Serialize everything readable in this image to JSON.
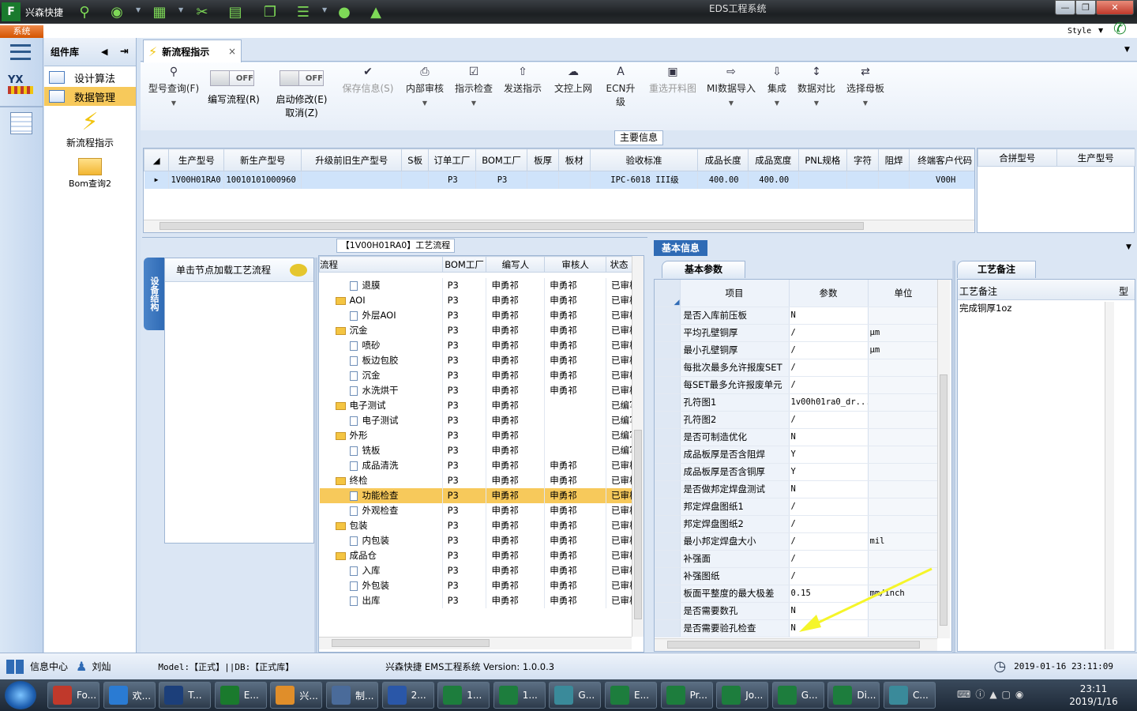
{
  "window": {
    "app_name": "兴森快捷",
    "title": "EDS工程系统",
    "style_label": "Style",
    "system_tab": "系统"
  },
  "sidebar": {
    "header": "组件库",
    "items": [
      {
        "label": "设计算法"
      },
      {
        "label": "数据管理"
      }
    ],
    "actions": [
      {
        "label": "新流程指示"
      },
      {
        "label": "Bom查询2"
      }
    ]
  },
  "tab": {
    "label": "新流程指示"
  },
  "toolbar": {
    "buttons": [
      {
        "label": "型号查询(F)"
      },
      {
        "label": "编写流程(R)",
        "state": "OFF"
      },
      {
        "label": "启动修改(E)",
        "label2": "取消(Z)",
        "state": "OFF"
      },
      {
        "label": "保存信息(S)"
      },
      {
        "label": "内部审核"
      },
      {
        "label": "指示检查"
      },
      {
        "label": "发送指示"
      },
      {
        "label": "文控上网"
      },
      {
        "label": "ECN升级"
      },
      {
        "label": "重选开料图"
      },
      {
        "label": "MI数据导入"
      },
      {
        "label": "集成"
      },
      {
        "label": "数据对比"
      },
      {
        "label": "选择母板"
      }
    ]
  },
  "main_info": {
    "title": "主要信息",
    "columns": [
      "生产型号",
      "新生产型号",
      "升级前旧生产型号",
      "S板",
      "订单工厂",
      "BOM工厂",
      "板厚",
      "板材",
      "验收标准",
      "成品长度",
      "成品宽度",
      "PNL规格",
      "字符",
      "阻焊",
      "终端客户代码"
    ],
    "row": [
      "1V00H01RA0",
      "10010101000960",
      "",
      "",
      "P3",
      "P3",
      "",
      "",
      "IPC-6018 III级",
      "400.00",
      "400.00",
      "",
      "",
      "",
      "V00H"
    ],
    "extra_columns": [
      "合拼型号",
      "生产型号"
    ]
  },
  "process": {
    "title": "【1V00H01RA0】工艺流程",
    "side_tab": "设备结构",
    "load_hint": "单击节点加载工艺流程",
    "columns": [
      "流程",
      "BOM工厂",
      "编写人",
      "审核人",
      "状态"
    ],
    "rows": [
      {
        "name": "退膜",
        "type": "doc",
        "bom": "P3",
        "writer": "申勇祁",
        "reviewer": "申勇祁",
        "status": "已审核"
      },
      {
        "name": "AOI",
        "type": "folder",
        "bom": "P3",
        "writer": "申勇祁",
        "reviewer": "申勇祁",
        "status": "已审核"
      },
      {
        "name": "外层AOI",
        "type": "doc",
        "bom": "P3",
        "writer": "申勇祁",
        "reviewer": "申勇祁",
        "status": "已审核"
      },
      {
        "name": "沉金",
        "type": "folder",
        "bom": "P3",
        "writer": "申勇祁",
        "reviewer": "申勇祁",
        "status": "已审核"
      },
      {
        "name": "喷砂",
        "type": "doc",
        "bom": "P3",
        "writer": "申勇祁",
        "reviewer": "申勇祁",
        "status": "已审核"
      },
      {
        "name": "板边包胶",
        "type": "doc",
        "bom": "P3",
        "writer": "申勇祁",
        "reviewer": "申勇祁",
        "status": "已审核"
      },
      {
        "name": "沉金",
        "type": "doc",
        "bom": "P3",
        "writer": "申勇祁",
        "reviewer": "申勇祁",
        "status": "已审核"
      },
      {
        "name": "水洗烘干",
        "type": "doc",
        "bom": "P3",
        "writer": "申勇祁",
        "reviewer": "申勇祁",
        "status": "已审核"
      },
      {
        "name": "电子测试",
        "type": "folder",
        "bom": "P3",
        "writer": "申勇祁",
        "reviewer": "",
        "status": "已编写"
      },
      {
        "name": "电子测试",
        "type": "doc",
        "bom": "P3",
        "writer": "申勇祁",
        "reviewer": "",
        "status": "已编写"
      },
      {
        "name": "外形",
        "type": "folder",
        "bom": "P3",
        "writer": "申勇祁",
        "reviewer": "",
        "status": "已编写"
      },
      {
        "name": "铣板",
        "type": "doc",
        "bom": "P3",
        "writer": "申勇祁",
        "reviewer": "",
        "status": "已编写"
      },
      {
        "name": "成品清洗",
        "type": "doc",
        "bom": "P3",
        "writer": "申勇祁",
        "reviewer": "申勇祁",
        "status": "已审核"
      },
      {
        "name": "终检",
        "type": "folder",
        "bom": "P3",
        "writer": "申勇祁",
        "reviewer": "申勇祁",
        "status": "已审核"
      },
      {
        "name": "功能检查",
        "type": "doc",
        "bom": "P3",
        "writer": "申勇祁",
        "reviewer": "申勇祁",
        "status": "已审核",
        "selected": true
      },
      {
        "name": "外观检查",
        "type": "doc",
        "bom": "P3",
        "writer": "申勇祁",
        "reviewer": "申勇祁",
        "status": "已审核"
      },
      {
        "name": "包装",
        "type": "folder",
        "bom": "P3",
        "writer": "申勇祁",
        "reviewer": "申勇祁",
        "status": "已审核"
      },
      {
        "name": "内包装",
        "type": "doc",
        "bom": "P3",
        "writer": "申勇祁",
        "reviewer": "申勇祁",
        "status": "已审核"
      },
      {
        "name": "成品仓",
        "type": "folder",
        "bom": "P3",
        "writer": "申勇祁",
        "reviewer": "申勇祁",
        "status": "已审核"
      },
      {
        "name": "入库",
        "type": "doc",
        "bom": "P3",
        "writer": "申勇祁",
        "reviewer": "申勇祁",
        "status": "已审核"
      },
      {
        "name": "外包装",
        "type": "doc",
        "bom": "P3",
        "writer": "申勇祁",
        "reviewer": "申勇祁",
        "status": "已审核"
      },
      {
        "name": "出库",
        "type": "doc",
        "bom": "P3",
        "writer": "申勇祁",
        "reviewer": "申勇祁",
        "status": "已审核"
      }
    ]
  },
  "basic_info": {
    "title": "基本信息",
    "tab": "基本参数",
    "columns": [
      "项目",
      "参数",
      "单位"
    ],
    "rows": [
      {
        "item": "是否入库前压板",
        "param": "N",
        "unit": ""
      },
      {
        "item": "平均孔壁铜厚",
        "param": "/",
        "unit": "μm"
      },
      {
        "item": "最小孔壁铜厚",
        "param": "/",
        "unit": "μm"
      },
      {
        "item": "每批次最多允许报废SET",
        "param": "/",
        "unit": ""
      },
      {
        "item": "每SET最多允许报废单元",
        "param": "/",
        "unit": ""
      },
      {
        "item": "孔符图1",
        "param": "1v00h01ra0_dr...",
        "unit": ""
      },
      {
        "item": "孔符图2",
        "param": "/",
        "unit": ""
      },
      {
        "item": "是否可制造优化",
        "param": "N",
        "unit": ""
      },
      {
        "item": "成品板厚是否含阻焊",
        "param": "Y",
        "unit": ""
      },
      {
        "item": "成品板厚是否含铜厚",
        "param": "Y",
        "unit": ""
      },
      {
        "item": "是否做邦定焊盘测试",
        "param": "N",
        "unit": ""
      },
      {
        "item": "邦定焊盘图纸1",
        "param": "/",
        "unit": ""
      },
      {
        "item": "邦定焊盘图纸2",
        "param": "/",
        "unit": ""
      },
      {
        "item": "最小邦定焊盘大小",
        "param": "/",
        "unit": "mil"
      },
      {
        "item": "补强面",
        "param": "/",
        "unit": ""
      },
      {
        "item": "补强图纸",
        "param": "/",
        "unit": ""
      },
      {
        "item": "板面平整度的最大极差",
        "param": "0.15",
        "unit": "mm/inch"
      },
      {
        "item": "是否需要数孔",
        "param": "N",
        "unit": ""
      },
      {
        "item": "是否需要验孔检查",
        "param": "N",
        "unit": ""
      }
    ]
  },
  "remarks": {
    "tab": "工艺备注",
    "col1": "工艺备注",
    "col2": "型",
    "value": "完成铜厚1oz"
  },
  "status": {
    "info_center": "信息中心",
    "user": "刘灿",
    "model": "Model:【正式】||DB:【正式库】",
    "version": "兴森快捷  EMS工程系统  Version: 1.0.0.3",
    "datetime": "2019-01-16 23:11:09"
  },
  "taskbar": {
    "items": [
      {
        "label": "Fo..."
      },
      {
        "label": "欢..."
      },
      {
        "label": "T..."
      },
      {
        "label": "E..."
      },
      {
        "label": "兴..."
      },
      {
        "label": "制..."
      },
      {
        "label": "2..."
      },
      {
        "label": "1..."
      },
      {
        "label": "1..."
      },
      {
        "label": "G..."
      },
      {
        "label": "E..."
      },
      {
        "label": "Pr..."
      },
      {
        "label": "Jo..."
      },
      {
        "label": "G..."
      },
      {
        "label": "Di..."
      },
      {
        "label": "C..."
      }
    ],
    "time": "23:11",
    "date": "2019/1/16"
  },
  "colors": {
    "selected_row": "#f7c95b",
    "highlight_row": "#cfe3fa",
    "annotation_arrow": "#f5f52a",
    "header_blue": "#2f6bb5"
  }
}
